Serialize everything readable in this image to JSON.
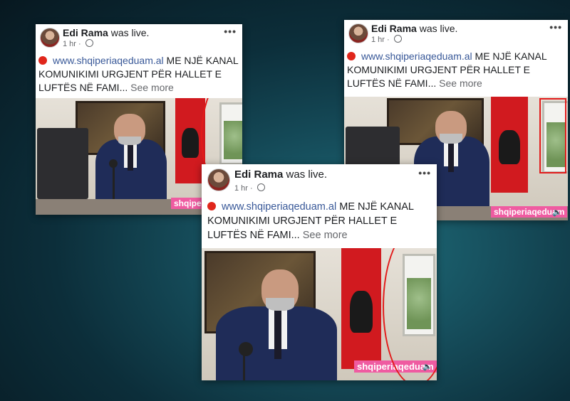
{
  "post": {
    "author": "Edi Rama",
    "action": "was live.",
    "time": "1 hr",
    "separator": "·",
    "menu": "•••",
    "link": "www.shqiperiaqeduam.al",
    "text_line1_rest": "ME NJË KANAL",
    "text_line2": "KOMUNIKIMI URGJENT PËR HALLET E",
    "text_line3": "LUFTËS NË FAMI...",
    "see_more": "See more",
    "watermark": "shqiperiaqeduam"
  },
  "icons": {
    "live_dot": "red-circle-icon",
    "privacy": "globe-icon",
    "options": "more-options-icon",
    "sound": "speaker-icon"
  },
  "colors": {
    "background": "#0c2e3a",
    "highlight": "#e21b1b",
    "watermark_bg": "#ef5ba1",
    "link": "#385898"
  }
}
